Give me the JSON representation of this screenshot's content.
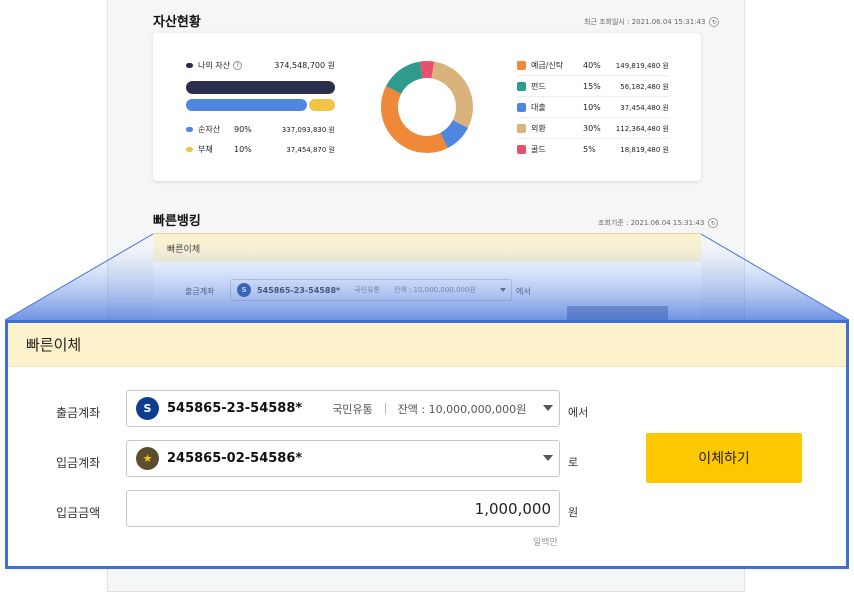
{
  "assets": {
    "title": "자산현황",
    "meta": "최근 조회일시 : 2021.06.04 15:31:43",
    "my_assets_label": "나의 자산",
    "my_assets_help": "?",
    "my_assets_value": "374,548,700 원",
    "net": {
      "label": "순자산",
      "pct": "90%",
      "value": "337,093,830 원",
      "color": "#4f86e0"
    },
    "debt": {
      "label": "부채",
      "pct": "10%",
      "value": "37,454,870 원",
      "color": "#f3c443"
    },
    "net_share": 0.9,
    "legend": [
      {
        "label": "예금/신탁",
        "pct": "40%",
        "value": "149,819,480 원",
        "color": "#f0883a"
      },
      {
        "label": "펀드",
        "pct": "15%",
        "value": "56,182,480 원",
        "color": "#2e9b8c"
      },
      {
        "label": "대출",
        "pct": "10%",
        "value": "37,454,480 원",
        "color": "#4f86e0"
      },
      {
        "label": "외환",
        "pct": "30%",
        "value": "112,364,480 원",
        "color": "#d9b27c"
      },
      {
        "label": "골드",
        "pct": "5%",
        "value": "18,819,480 원",
        "color": "#e8506b"
      }
    ]
  },
  "quick": {
    "title": "빠른뱅킹",
    "meta": "조회기준 : 2021.06.04 15:31:43",
    "panel_title": "빠른이체",
    "bg_from_label": "출금계좌",
    "bg_from_account": "545865-23-54588*",
    "bg_from_nick": "국민유통",
    "bg_from_balance": "잔액 : 10,000,000,000원",
    "bg_suffix": "에서"
  },
  "zoom": {
    "title": "빠른이체",
    "from": {
      "label": "출금계좌",
      "bank_glyph": "S",
      "bank_color": "#0d3d8f",
      "account": "545865-23-54588*",
      "nickname": "국민유통",
      "balance": "잔액 : 10,000,000,000원",
      "suffix": "에서"
    },
    "to": {
      "label": "입금계좌",
      "bank_glyph": "★",
      "bank_color": "#5b4d2d",
      "account": "245865-02-54586*",
      "suffix": "로"
    },
    "amount": {
      "label": "입금금액",
      "value": "1,000,000",
      "suffix": "원",
      "hint": "일백만"
    },
    "submit": "이체하기"
  }
}
